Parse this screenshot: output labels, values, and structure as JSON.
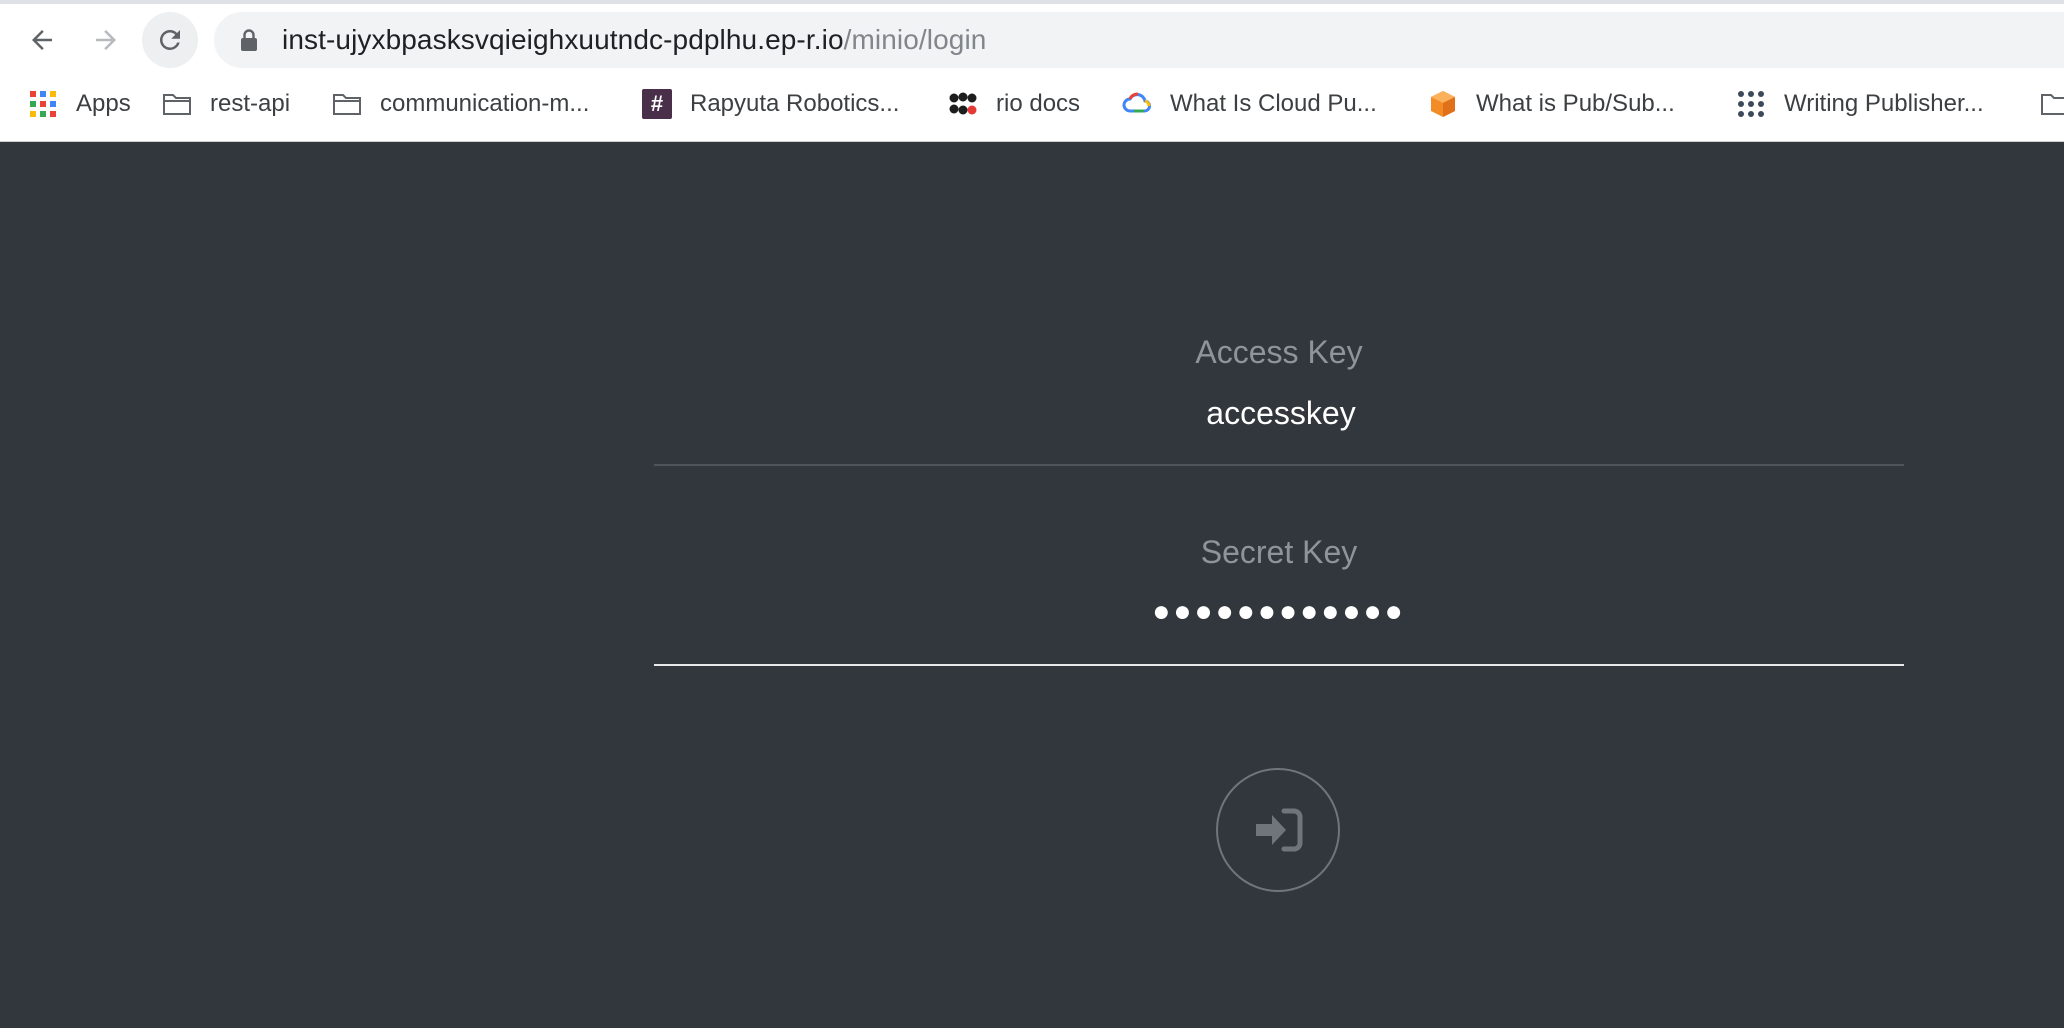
{
  "browser": {
    "url_host": "inst-ujyxbpasksvqieighxuutndc-pdplhu.ep-r.io",
    "url_path": "/minio/login",
    "bookmarks": [
      {
        "label": "Apps",
        "icon": "apps-grid-icon"
      },
      {
        "label": "rest-api",
        "icon": "folder-icon"
      },
      {
        "label": "communication-m...",
        "icon": "folder-icon"
      },
      {
        "label": "Rapyuta Robotics...",
        "icon": "slack-hash-icon"
      },
      {
        "label": "rio docs",
        "icon": "rio-logo-icon"
      },
      {
        "label": "What Is Cloud Pu...",
        "icon": "google-cloud-icon"
      },
      {
        "label": "What is Pub/Sub...",
        "icon": "orange-cube-icon"
      },
      {
        "label": "Writing Publisher...",
        "icon": "dots-grid-icon"
      }
    ]
  },
  "login": {
    "access_key_label": "Access Key",
    "access_key_value": "accesskey",
    "secret_key_label": "Secret Key",
    "secret_key_masked": "●●●●●●●●●●●●",
    "submit_icon": "sign-in-icon"
  },
  "colors": {
    "page_bg": "#32373d",
    "label": "#8e9499",
    "value": "#ffffff",
    "active_underline": "#e6e8ea"
  }
}
